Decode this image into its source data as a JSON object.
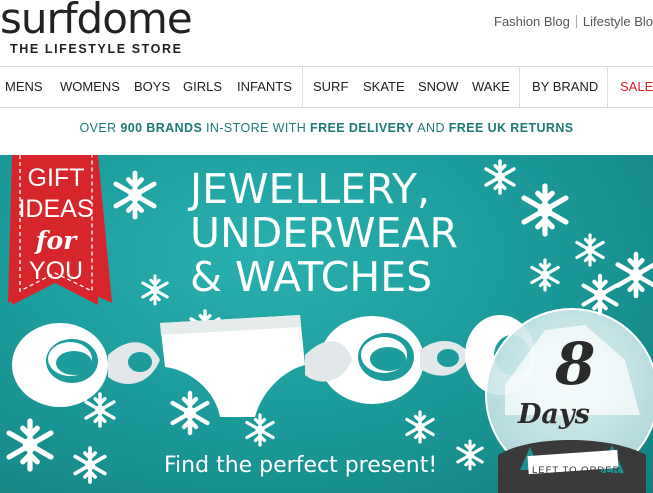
{
  "header": {
    "logo_text": "surfdome",
    "tagline": "THE LIFESTYLE STORE",
    "links": [
      "Fashion Blog",
      "Lifestyle Blo"
    ]
  },
  "nav": {
    "items": [
      "MENS",
      "WOMENS",
      "BOYS",
      "GIRLS",
      "INFANTS",
      "SURF",
      "SKATE",
      "SNOW",
      "WAKE",
      "BY BRAND",
      "SALE"
    ],
    "sale_color": "#d91f26"
  },
  "promo": {
    "part1": "OVER ",
    "part2": "900 BRANDS",
    "part3": " IN-STORE WITH ",
    "part4": "FREE DELIVERY",
    "part5": " AND ",
    "part6": "FREE UK RETURNS",
    "color": "#1e7a78"
  },
  "banner": {
    "ribbon_line1": "GIFT",
    "ribbon_line2": "IDEAS",
    "ribbon_line3": "for",
    "ribbon_line4": "YOU",
    "headline_line1": "JEWELLERY,",
    "headline_line2": "UNDERWEAR",
    "headline_line3": "& WATCHES",
    "subline": "Find the perfect present!",
    "countdown_number": "8",
    "countdown_word": "Days",
    "countdown_caption": "LEFT TO ORDER",
    "background_color": "#1c9c9d",
    "ribbon_color": "#d7262b"
  }
}
